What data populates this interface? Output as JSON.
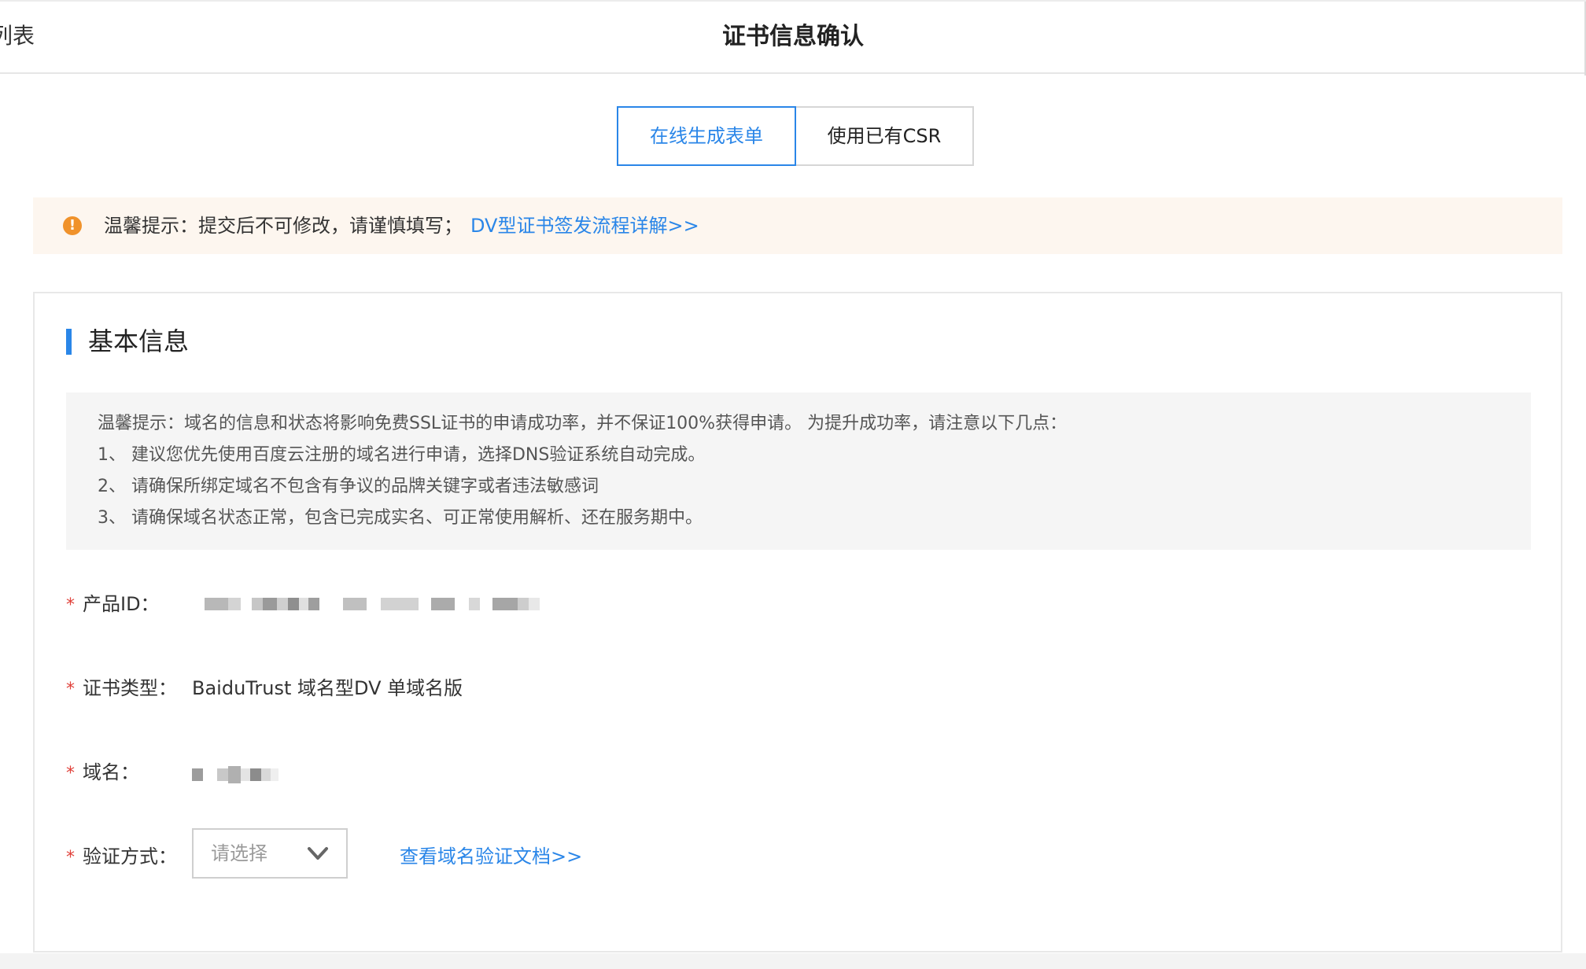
{
  "header": {
    "back_label": "列表",
    "title": "证书信息确认"
  },
  "tabs": [
    {
      "label": "在线生成表单",
      "active": true
    },
    {
      "label": "使用已有CSR",
      "active": false
    }
  ],
  "notice": {
    "icon": "warning-circle-icon",
    "text": "温馨提示：提交后不可修改，请谨慎填写；",
    "link": "DV型证书签发流程详解>>"
  },
  "section": {
    "title": "基本信息",
    "tips": [
      "温馨提示：域名的信息和状态将影响免费SSL证书的申请成功率，并不保证100%获得申请。 为提升成功率，请注意以下几点：",
      "1、 建议您优先使用百度云注册的域名进行申请，选择DNS验证系统自动完成。",
      "2、 请确保所绑定域名不包含有争议的品牌关键字或者违法敏感词",
      "3、 请确保域名状态正常，包含已完成实名、可正常使用解析、还在服务期中。"
    ]
  },
  "form": {
    "required_mark": "*",
    "product_id_label": "产品ID：",
    "cert_type_label": "证书类型：",
    "cert_type_value": "BaiduTrust 域名型DV 单域名版",
    "domain_label": "域名：",
    "verify_label": "验证方式：",
    "verify_placeholder": "请选择",
    "verify_doc_link": "查看域名验证文档>>"
  },
  "colors": {
    "accent": "#2a86e8",
    "warning": "#f0922b",
    "required": "#e0413a",
    "notice_bg": "#fdf6ef"
  }
}
